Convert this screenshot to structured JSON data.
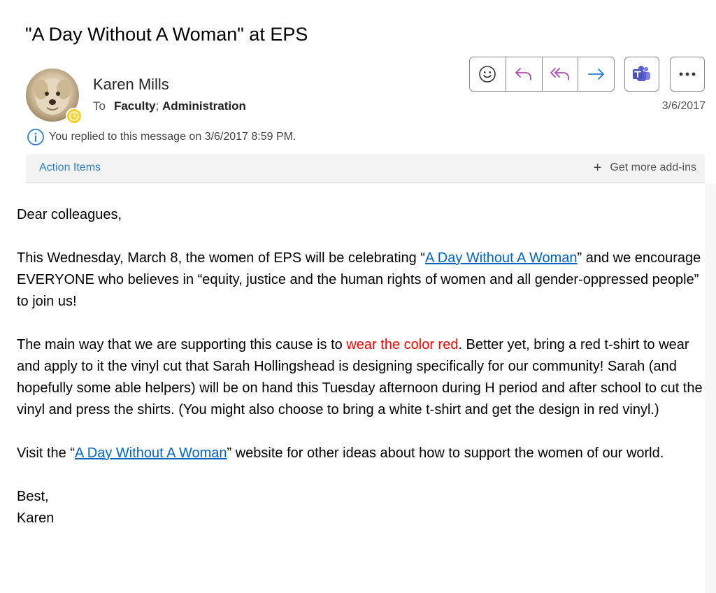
{
  "header": {
    "subject": "\"A Day Without A Woman\" at EPS",
    "sender_name": "Karen Mills",
    "to_label": "To",
    "recipients": [
      "Faculty",
      "Administration"
    ],
    "recipient_separator": "; ",
    "date": "3/6/2017",
    "info_text": "You replied to this message on 3/6/2017 8:59 PM."
  },
  "toolbar": {
    "buttons": [
      "emoji-icon",
      "reply-icon",
      "reply-all-icon",
      "forward-icon",
      "teams-icon",
      "more-options-icon"
    ]
  },
  "addins": {
    "action_items": "Action Items",
    "get_more": "Get more add-ins"
  },
  "body": {
    "greeting": "Dear colleagues,",
    "p1_before": "This Wednesday, March 8, the women of EPS will be celebrating “",
    "p1_link": "A Day Without A Woman",
    "p1_after": "” and we encourage EVERYONE who believes in “equity, justice and the human rights of women and all gender-oppressed people” to join us!",
    "p2_before": "The main way that we are supporting this cause is to ",
    "p2_red": "wear the color red",
    "p2_after": ". Better yet, bring a red t-shirt to wear and apply to it the vinyl cut that Sarah Hollingshead is designing specifically for our community! Sarah (and hopefully some able helpers) will be on hand this Tuesday afternoon during H period and after school to cut the vinyl and press the shirts. (You might also choose to bring a white t-shirt and get the design in red vinyl.)",
    "p3_before": "Visit the “",
    "p3_link": "A Day Without A Woman",
    "p3_after": "” website for other ideas about how to support the women of our world.",
    "closing": "Best,",
    "signature": "Karen"
  },
  "colors": {
    "link": "#0563c1",
    "highlight_red": "#ff0000",
    "action_items": "#2d7fc8",
    "reply_purple": "#b14ab5",
    "forward_blue": "#1e7fd6",
    "teams_purple": "#5b5fc7",
    "presence_yellow": "#f8d22a"
  }
}
